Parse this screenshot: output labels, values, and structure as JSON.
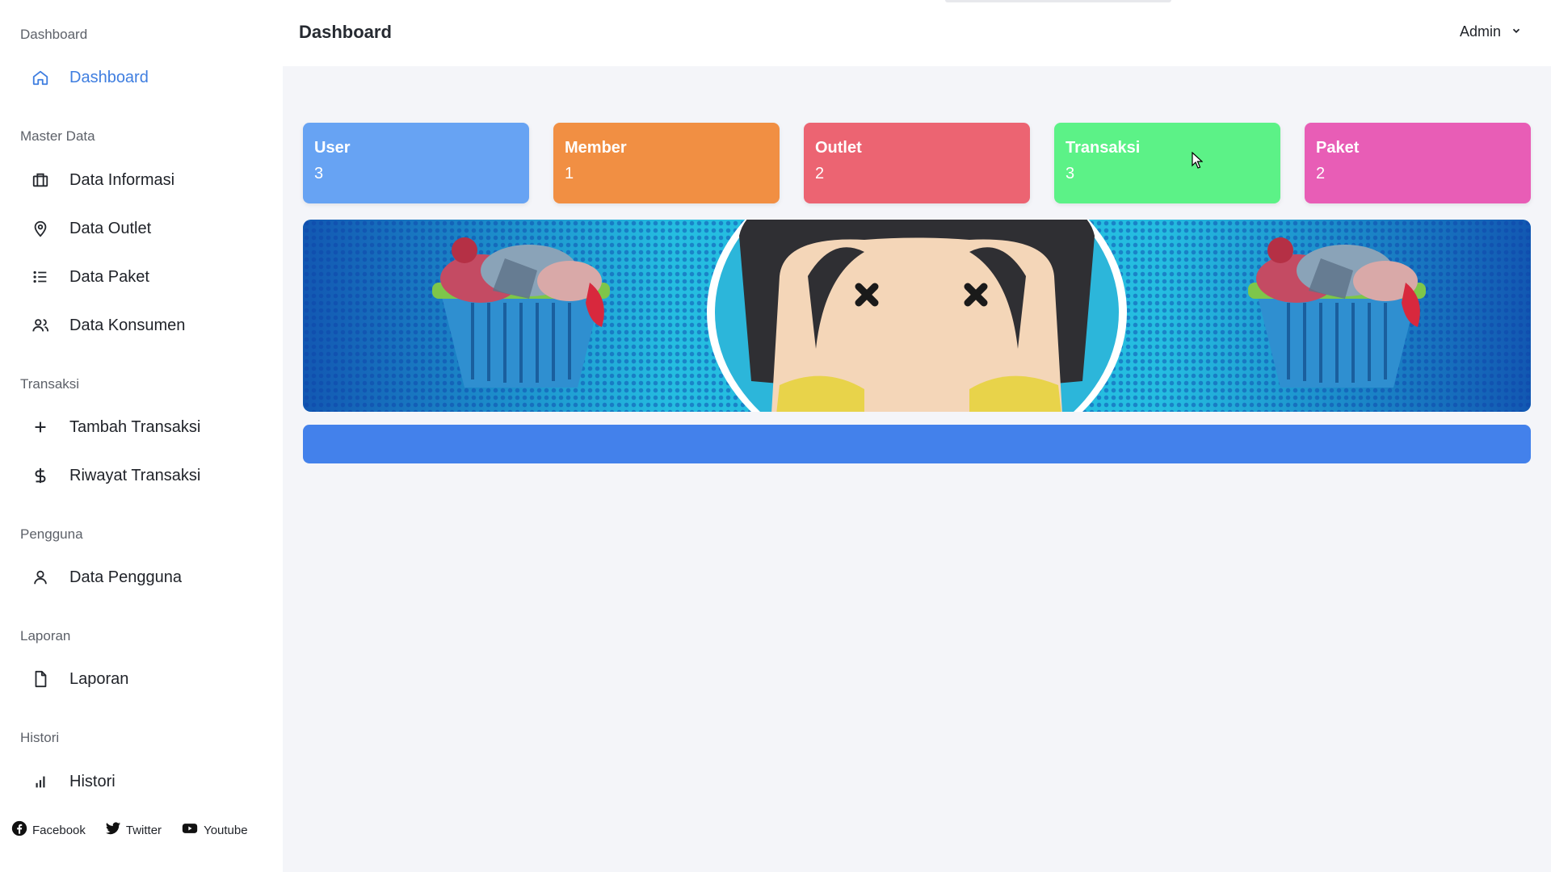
{
  "header": {
    "title": "Dashboard",
    "user": "Admin"
  },
  "sidebar": {
    "sections": [
      {
        "title": "Dashboard",
        "items": [
          {
            "label": "Dashboard",
            "icon": "home-icon",
            "active": true
          }
        ]
      },
      {
        "title": "Master Data",
        "items": [
          {
            "label": "Data Informasi",
            "icon": "briefcase-icon"
          },
          {
            "label": "Data Outlet",
            "icon": "location-pin-icon"
          },
          {
            "label": "Data Paket",
            "icon": "list-icon"
          },
          {
            "label": "Data Konsumen",
            "icon": "users-icon"
          }
        ]
      },
      {
        "title": "Transaksi",
        "items": [
          {
            "label": "Tambah Transaksi",
            "icon": "plus-icon"
          },
          {
            "label": "Riwayat Transaksi",
            "icon": "dollar-icon"
          }
        ]
      },
      {
        "title": "Pengguna",
        "items": [
          {
            "label": "Data Pengguna",
            "icon": "user-icon"
          }
        ]
      },
      {
        "title": "Laporan",
        "items": [
          {
            "label": "Laporan",
            "icon": "file-icon"
          }
        ]
      },
      {
        "title": "Histori",
        "items": [
          {
            "label": "Histori",
            "icon": "bar-chart-icon"
          }
        ]
      }
    ]
  },
  "cards": [
    {
      "title": "User",
      "value": "3",
      "color": "#67a3f3"
    },
    {
      "title": "Member",
      "value": "1",
      "color": "#f18f43"
    },
    {
      "title": "Outlet",
      "value": "2",
      "color": "#ec6472"
    },
    {
      "title": "Transaksi",
      "value": "3",
      "color": "#5cf287"
    },
    {
      "title": "Paket",
      "value": "2",
      "color": "#e85db6"
    }
  ],
  "social": [
    {
      "label": "Facebook",
      "icon": "facebook-icon"
    },
    {
      "label": "Twitter",
      "icon": "twitter-icon"
    },
    {
      "label": "Youtube",
      "icon": "youtube-icon"
    }
  ],
  "colors": {
    "accent": "#3f7ee0",
    "bar": "#4381eb",
    "banner": "#25bde0"
  }
}
